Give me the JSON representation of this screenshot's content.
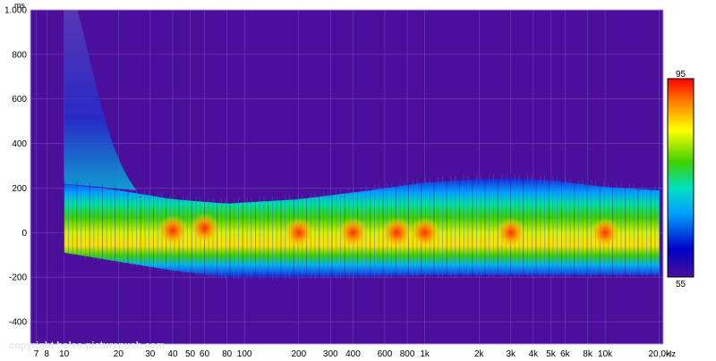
{
  "chart_data": {
    "type": "heatmap",
    "subtype": "waterfall-spectrogram",
    "title": "",
    "xlabel": "",
    "ylabel": "",
    "x_unit": "Hz",
    "y_unit": "ms",
    "x_scale": "log",
    "xlim": [
      6.5,
      21000
    ],
    "ylim": [
      -500,
      1000
    ],
    "x_ticks": [
      7,
      8,
      10,
      20,
      30,
      40,
      50,
      60,
      80,
      100,
      200,
      300,
      400,
      600,
      800,
      1000,
      2000,
      3000,
      4000,
      5000,
      6000,
      8000,
      10000,
      20000
    ],
    "x_tick_labels": [
      "7",
      "8",
      "10",
      "20",
      "30",
      "40",
      "50",
      "60",
      "80",
      "100",
      "200",
      "300",
      "400",
      "600",
      "800",
      "1k",
      "2k",
      "3k",
      "4k",
      "5k",
      "6k",
      "8k",
      "10k",
      "20,0k"
    ],
    "y_ticks": [
      1000,
      800,
      600,
      400,
      200,
      0,
      -200,
      -400
    ],
    "y_tick_labels": [
      "1.000",
      "800",
      "600",
      "400",
      "200",
      "0",
      "-200",
      "-400"
    ],
    "grid": true,
    "colorbar": {
      "min": 55,
      "max": 95,
      "min_label": "55",
      "max_label": "95",
      "placement": "right"
    },
    "colors": {
      "background": "#4b0f9c",
      "scale": [
        "#4b0f9c",
        "#0000c8",
        "#00a0ff",
        "#00e0c0",
        "#40d000",
        "#ffff00",
        "#ff8000",
        "#ff0000"
      ]
    },
    "band_envelope": {
      "freq_hz": [
        10,
        20,
        40,
        80,
        200,
        500,
        1000,
        2000,
        3000,
        5000,
        10000,
        20000
      ],
      "top_ms": [
        220,
        190,
        150,
        130,
        150,
        190,
        225,
        240,
        245,
        235,
        205,
        190
      ],
      "bottom_ms": [
        -90,
        -130,
        -170,
        -200,
        -200,
        -195,
        -190,
        -190,
        -190,
        -190,
        -190,
        -190
      ]
    },
    "hot_spots": [
      {
        "freq_hz": 40,
        "ms": 10,
        "level": 91
      },
      {
        "freq_hz": 60,
        "ms": 20,
        "level": 90
      },
      {
        "freq_hz": 200,
        "ms": 0,
        "level": 89
      },
      {
        "freq_hz": 400,
        "ms": 0,
        "level": 89
      },
      {
        "freq_hz": 700,
        "ms": 0,
        "level": 92
      },
      {
        "freq_hz": 1000,
        "ms": 0,
        "level": 90
      },
      {
        "freq_hz": 3000,
        "ms": 0,
        "level": 88
      },
      {
        "freq_hz": 10000,
        "ms": 0,
        "level": 88
      }
    ],
    "low_frequency_tail": {
      "freq_hz_range": [
        10,
        20
      ],
      "top_ms": 1000,
      "level": 62
    }
  },
  "copyright": "copyright holso.picturepush.com"
}
